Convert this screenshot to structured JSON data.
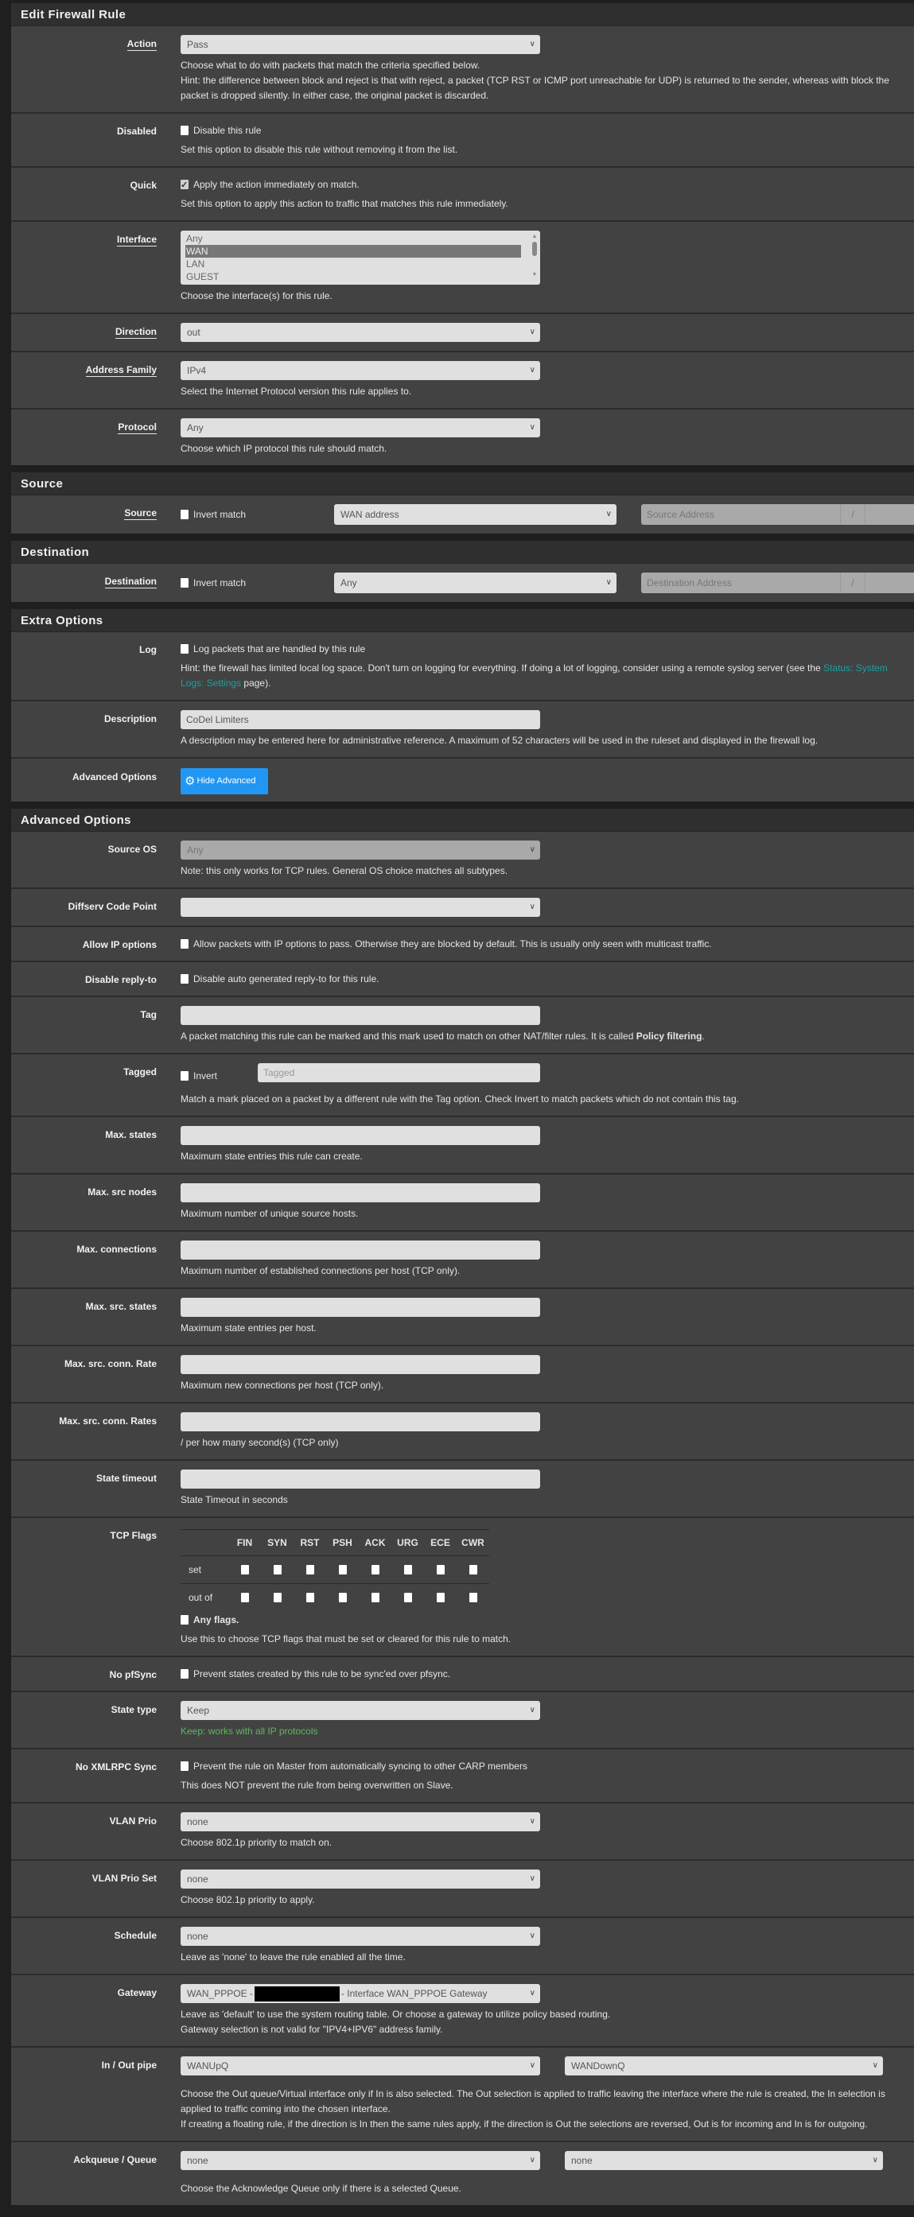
{
  "sections": [
    {
      "title": "Edit Firewall Rule",
      "rows": [
        {
          "label": "Action",
          "underline": true,
          "type": "select",
          "value": "Pass",
          "help": [
            "Choose what to do with packets that match the criteria specified below.",
            "Hint: the difference between block and reject is that with reject, a packet (TCP RST or ICMP port unreachable for UDP) is returned to the sender, whereas with block the packet is dropped silently. In either case, the original packet is discarded."
          ]
        },
        {
          "label": "Disabled",
          "type": "checkbox",
          "checked": false,
          "check_label": "Disable this rule",
          "help": [
            "Set this option to disable this rule without removing it from the list."
          ]
        },
        {
          "label": "Quick",
          "type": "checkbox",
          "checked": true,
          "check_label": "Apply the action immediately on match.",
          "help": [
            "Set this option to apply this action to traffic that matches this rule immediately."
          ]
        },
        {
          "label": "Interface",
          "underline": true,
          "type": "listbox",
          "options": [
            "Any",
            "WAN",
            "LAN",
            "GUEST"
          ],
          "selected": "WAN",
          "help": [
            "Choose the interface(s) for this rule."
          ]
        },
        {
          "label": "Direction",
          "underline": true,
          "type": "select",
          "value": "out"
        },
        {
          "label": "Address Family",
          "underline": true,
          "type": "select",
          "value": "IPv4",
          "help": [
            "Select the Internet Protocol version this rule applies to."
          ]
        },
        {
          "label": "Protocol",
          "underline": true,
          "type": "select",
          "value": "Any",
          "help": [
            "Choose which IP protocol this rule should match."
          ]
        }
      ]
    },
    {
      "title": "Source",
      "rows": [
        {
          "label": "Source",
          "underline": true,
          "type": "address",
          "invert_label": "Invert match",
          "value": "WAN address",
          "address_placeholder": "Source Address",
          "slash": "/"
        }
      ]
    },
    {
      "title": "Destination",
      "rows": [
        {
          "label": "Destination",
          "underline": true,
          "type": "address",
          "invert_label": "Invert match",
          "value": "Any",
          "address_placeholder": "Destination Address",
          "slash": "/"
        }
      ]
    },
    {
      "title": "Extra Options",
      "rows": [
        {
          "label": "Log",
          "type": "checkbox",
          "checked": false,
          "check_label": "Log packets that are handled by this rule",
          "help": [
            [
              {
                "text": "Hint: the firewall has limited local log space. Don't turn on logging for everything. If doing a lot of logging, consider using a remote syslog server (see the "
              },
              {
                "text": "Status: System Logs: Settings",
                "style": "link"
              },
              {
                "text": " page)."
              }
            ]
          ]
        },
        {
          "label": "Description",
          "type": "input",
          "value": "CoDel Limiters",
          "help": [
            "A description may be entered here for administrative reference. A maximum of 52 characters will be used in the ruleset and displayed in the firewall log."
          ]
        },
        {
          "label": "Advanced Options",
          "type": "button",
          "button_label": "Hide Advanced",
          "icon": "gear-icon"
        }
      ]
    },
    {
      "title": "Advanced Options",
      "rows": [
        {
          "label": "Source OS",
          "type": "select",
          "value": "Any",
          "disabled": true,
          "help": [
            "Note: this only works for TCP rules. General OS choice matches all subtypes."
          ]
        },
        {
          "label": "Diffserv Code Point",
          "type": "select",
          "value": ""
        },
        {
          "label": "Allow IP options",
          "type": "checkbox",
          "checked": false,
          "check_label": "Allow packets with IP options to pass. Otherwise they are blocked by default. This is usually only seen with multicast traffic."
        },
        {
          "label": "Disable reply-to",
          "type": "checkbox",
          "checked": false,
          "check_label": "Disable auto generated reply-to for this rule."
        },
        {
          "label": "Tag",
          "type": "input",
          "value": "",
          "help": [
            [
              {
                "text": "A packet matching this rule can be marked and this mark used to match on other NAT/filter rules. It is called "
              },
              {
                "text": "Policy filtering",
                "style": "bold"
              },
              {
                "text": "."
              }
            ]
          ]
        },
        {
          "label": "Tagged",
          "type": "tagged",
          "invert_label": "Invert",
          "placeholder": "Tagged",
          "help": [
            "Match a mark placed on a packet by a different rule with the Tag option. Check Invert to match packets which do not contain this tag."
          ]
        },
        {
          "label": "Max. states",
          "type": "input",
          "value": "",
          "help": [
            "Maximum state entries this rule can create."
          ]
        },
        {
          "label": "Max. src nodes",
          "type": "input",
          "value": "",
          "help": [
            "Maximum number of unique source hosts."
          ]
        },
        {
          "label": "Max. connections",
          "type": "input",
          "value": "",
          "help": [
            "Maximum number of established connections per host (TCP only)."
          ]
        },
        {
          "label": "Max. src. states",
          "type": "input",
          "value": "",
          "help": [
            "Maximum state entries per host."
          ]
        },
        {
          "label": "Max. src. conn. Rate",
          "type": "input",
          "value": "",
          "help": [
            "Maximum new connections per host (TCP only)."
          ]
        },
        {
          "label": "Max. src. conn. Rates",
          "type": "input",
          "value": "",
          "help": [
            "/ per how many second(s) (TCP only)"
          ]
        },
        {
          "label": "State timeout",
          "type": "input",
          "value": "",
          "help": [
            "State Timeout in seconds"
          ]
        },
        {
          "label": "TCP Flags",
          "type": "tcpflags",
          "flags": [
            "FIN",
            "SYN",
            "RST",
            "PSH",
            "ACK",
            "URG",
            "ECE",
            "CWR"
          ],
          "row_labels": [
            "set",
            "out of"
          ],
          "any_label": "Any flags.",
          "help": [
            "Use this to choose TCP flags that must be set or cleared for this rule to match."
          ]
        },
        {
          "label": "No pfSync",
          "type": "checkbox",
          "checked": false,
          "check_label": "Prevent states created by this rule to be sync'ed over pfsync."
        },
        {
          "label": "State type",
          "type": "select",
          "value": "Keep",
          "help_color": "#5cb85c",
          "help": [
            "Keep: works with all IP protocols"
          ]
        },
        {
          "label": "No XMLRPC Sync",
          "type": "checkbox",
          "checked": false,
          "check_label": "Prevent the rule on Master from automatically syncing to other CARP members",
          "help": [
            "This does NOT prevent the rule from being overwritten on Slave."
          ]
        },
        {
          "label": "VLAN Prio",
          "type": "select",
          "value": "none",
          "help": [
            "Choose 802.1p priority to match on."
          ]
        },
        {
          "label": "VLAN Prio Set",
          "type": "select",
          "value": "none",
          "help": [
            "Choose 802.1p priority to apply."
          ]
        },
        {
          "label": "Schedule",
          "type": "select",
          "value": "none",
          "help": [
            "Leave as 'none' to leave the rule enabled all the time."
          ]
        },
        {
          "label": "Gateway",
          "type": "gateway",
          "value_prefix": "WAN_PPPOE -",
          "value_suffix": "- Interface WAN_PPPOE Gateway",
          "help": [
            "Leave as 'default' to use the system routing table. Or choose a gateway to utilize policy based routing.",
            "Gateway selection is not valid for \"IPV4+IPV6\" address family."
          ]
        },
        {
          "label": "In / Out pipe",
          "type": "dualselect",
          "values": [
            "WANUpQ",
            "WANDownQ"
          ],
          "help": [
            "Choose the Out queue/Virtual interface only if In is also selected. The Out selection is applied to traffic leaving the interface where the rule is created, the In selection is applied to traffic coming into the chosen interface.",
            "If creating a floating rule, if the direction is In then the same rules apply, if the direction is Out the selections are reversed, Out is for incoming and In is for outgoing."
          ]
        },
        {
          "label": "Ackqueue / Queue",
          "type": "dualselect",
          "values": [
            "none",
            "none"
          ],
          "help": [
            "Choose the Acknowledge Queue only if there is a selected Queue."
          ]
        }
      ]
    }
  ]
}
